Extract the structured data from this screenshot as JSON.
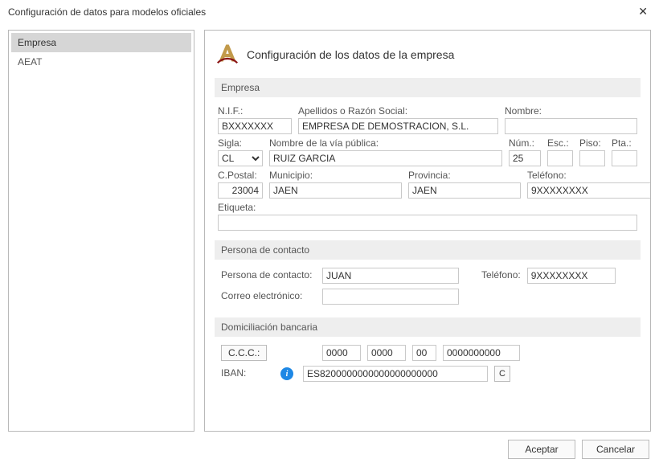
{
  "window": {
    "title": "Configuración de datos para modelos oficiales"
  },
  "sidebar": {
    "items": [
      {
        "label": "Empresa"
      },
      {
        "label": "AEAT"
      }
    ]
  },
  "main": {
    "title": "Configuración de los datos de la empresa",
    "sections": {
      "empresa": {
        "title": "Empresa",
        "labels": {
          "nif": "N.I.F.:",
          "razon": "Apellidos o Razón Social:",
          "nombre": "Nombre:",
          "sigla": "Sigla:",
          "via": "Nombre de la vía pública:",
          "num": "Núm.:",
          "esc": "Esc.:",
          "piso": "Piso:",
          "pta": "Pta.:",
          "cpostal": "C.Postal:",
          "municipio": "Municipio:",
          "provincia": "Provincia:",
          "telefono": "Teléfono:",
          "etiqueta": "Etiqueta:"
        },
        "values": {
          "nif": "BXXXXXXX",
          "razon": "EMPRESA DE DEMOSTRACION, S.L.",
          "nombre": "",
          "sigla": "CL",
          "via": "RUIZ GARCIA",
          "num": "25",
          "esc": "",
          "piso": "",
          "pta": "",
          "cpostal": "23004",
          "municipio": "JAEN",
          "provincia": "JAEN",
          "telefono": "9XXXXXXXX",
          "etiqueta": ""
        }
      },
      "contacto": {
        "title": "Persona de contacto",
        "labels": {
          "persona": "Persona de contacto:",
          "telefono": "Teléfono:",
          "correo": "Correo electrónico:"
        },
        "values": {
          "persona": "JUAN",
          "telefono": "9XXXXXXXX",
          "correo": ""
        }
      },
      "banco": {
        "title": "Domiciliación bancaria",
        "labels": {
          "ccc": "C.C.C.:",
          "iban": "IBAN:",
          "ibanCheck": "C"
        },
        "values": {
          "ccc1": "0000",
          "ccc2": "0000",
          "ccc3": "00",
          "ccc4": "0000000000",
          "iban": "ES8200000000000000000000"
        }
      }
    }
  },
  "buttons": {
    "accept": "Aceptar",
    "cancel": "Cancelar"
  },
  "colors": {
    "accent": "#1e88e5",
    "selection": "#d6d6d6",
    "border": "#b9b9b9"
  }
}
